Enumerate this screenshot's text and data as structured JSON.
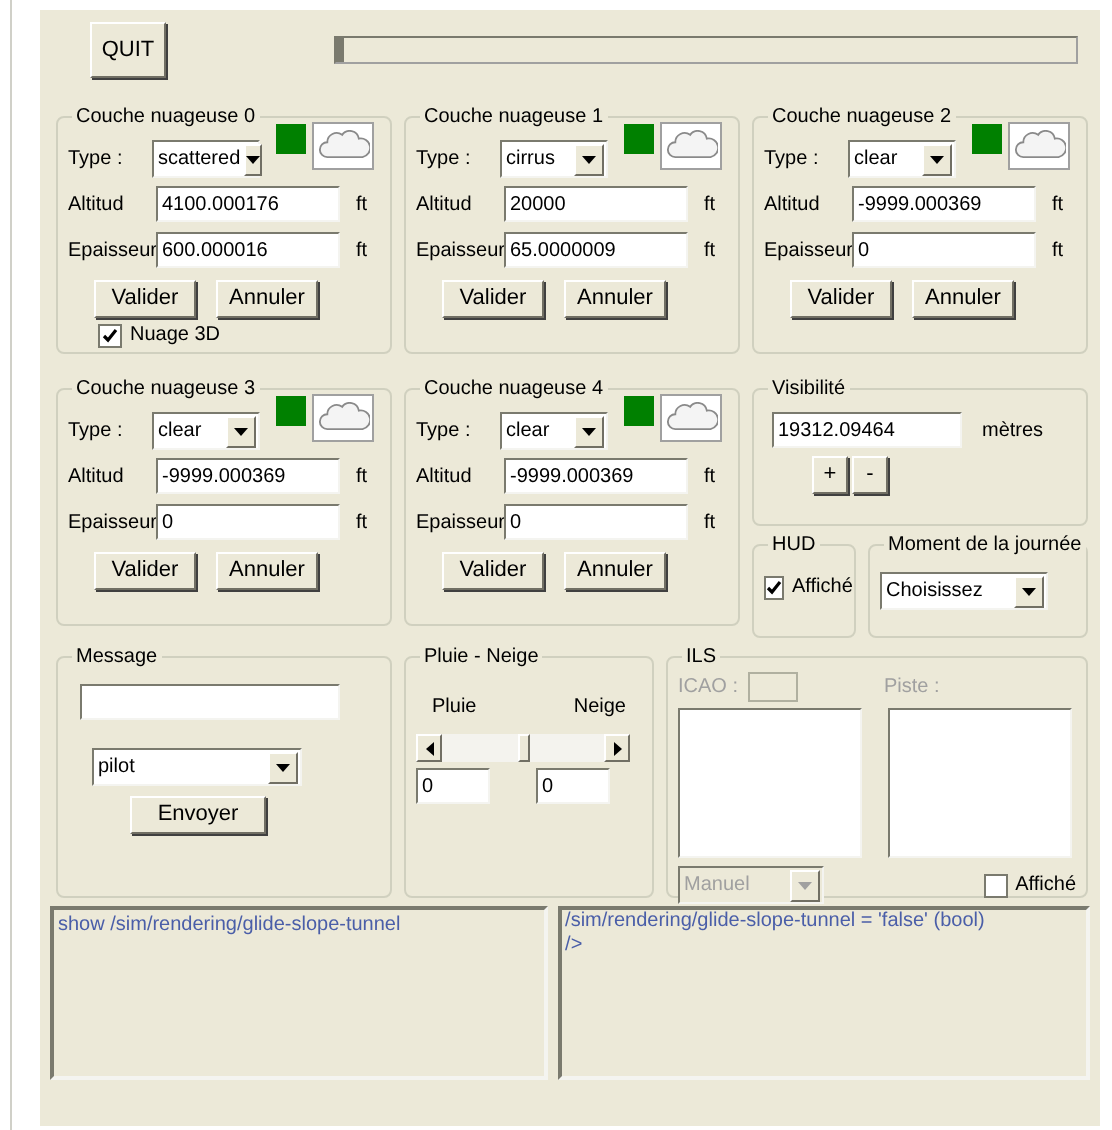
{
  "toolbar": {
    "quit_button": "QUIT",
    "progress": {
      "level": 0.01
    }
  },
  "cloud_layers": [
    {
      "title": "Couche nuageuse 0",
      "type_label": "Type :",
      "type": "scattered",
      "altitude_label": "Altitud",
      "altitude": "4100.000176",
      "altitude_unit": "ft",
      "thickness_label": "Epaisseur",
      "thickness": "600.000016",
      "thickness_unit": "ft",
      "buttons": [
        "Valider",
        "Annuler"
      ],
      "nuage_3d": {
        "label": "Nuage 3D",
        "checked": true
      }
    },
    {
      "title": "Couche nuageuse 1",
      "type_label": "Type :",
      "type": "cirrus",
      "altitude_label": "Altitud",
      "altitude": "20000",
      "altitude_unit": "ft",
      "thickness_label": "Epaisseur",
      "thickness": "65.0000009",
      "thickness_unit": "ft",
      "buttons": [
        "Valider",
        "Annuler"
      ]
    },
    {
      "title": "Couche nuageuse 2",
      "type_label": "Type :",
      "type": "clear",
      "altitude_label": "Altitud",
      "altitude": "-9999.000369",
      "altitude_unit": "ft",
      "thickness_label": "Epaisseur",
      "thickness": "0",
      "thickness_unit": "ft",
      "buttons": [
        "Valider",
        "Annuler"
      ]
    },
    {
      "title": "Couche nuageuse 3",
      "type_label": "Type :",
      "type": "clear",
      "altitude_label": "Altitud",
      "altitude": "-9999.000369",
      "altitude_unit": "ft",
      "thickness_label": "Epaisseur",
      "thickness": "0",
      "thickness_unit": "ft",
      "buttons": [
        "Valider",
        "Annuler"
      ]
    },
    {
      "title": "Couche nuageuse 4",
      "type_label": "Type :",
      "type": "clear",
      "altitude_label": "Altitud",
      "altitude": "-9999.000369",
      "altitude_unit": "ft",
      "thickness_label": "Epaisseur",
      "thickness": "0",
      "thickness_unit": "ft",
      "buttons": [
        "Valider",
        "Annuler"
      ]
    }
  ],
  "visibility": {
    "title": "Visibilité",
    "value": "19312.09464",
    "unit": "mètres",
    "buttons": [
      "+",
      "-"
    ]
  },
  "hud": {
    "title": "HUD",
    "checkbox": {
      "label": "Affiché",
      "checked": true
    }
  },
  "time_of_day": {
    "title": "Moment de la journée",
    "value": "Choisissez"
  },
  "message": {
    "title": "Message",
    "recipient": "pilot",
    "send_button": "Envoyer"
  },
  "precipitation": {
    "title": "Pluie - Neige",
    "left_label": "Pluie",
    "right_label": "Neige",
    "slider": {
      "level": 0.5
    },
    "rain": "0",
    "snow": "0"
  },
  "ils": {
    "title": "ILS",
    "icao_label": "ICAO :",
    "runway_label": "Piste :",
    "disabled": true,
    "mode": "Manuel",
    "checkbox": {
      "label": "Affiché",
      "checked": false
    }
  },
  "console": {
    "command": "show /sim/rendering/glide-slope-tunnel",
    "output": [
      "/sim/rendering/glide-slope-tunnel = 'false' (bool)",
      "/>"
    ]
  }
}
